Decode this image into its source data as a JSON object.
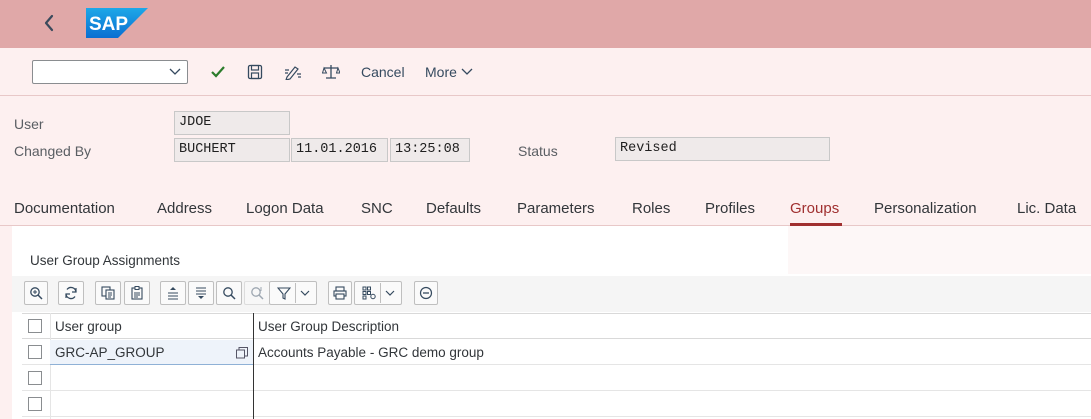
{
  "header": {
    "logo_text": "SAP",
    "brand_color": "#0a6ed1"
  },
  "toolbar": {
    "command_field_value": "",
    "cancel_label": "Cancel",
    "more_label": "More"
  },
  "form": {
    "user_label": "User",
    "user_value": "JDOE",
    "changed_by_label": "Changed By",
    "changed_by_value": "BUCHERT",
    "changed_date": "11.01.2016",
    "changed_time": "13:25:08",
    "status_label": "Status",
    "status_value": "Revised"
  },
  "tabs": [
    {
      "label": "Documentation"
    },
    {
      "label": "Address"
    },
    {
      "label": "Logon Data"
    },
    {
      "label": "SNC"
    },
    {
      "label": "Defaults"
    },
    {
      "label": "Parameters"
    },
    {
      "label": "Roles"
    },
    {
      "label": "Profiles"
    },
    {
      "label": "Groups",
      "active": true
    },
    {
      "label": "Personalization"
    },
    {
      "label": "Lic. Data"
    }
  ],
  "section": {
    "title": "User Group Assignments"
  },
  "grid": {
    "columns": [
      "User group",
      "User Group Description"
    ],
    "rows": [
      {
        "group": "GRC-AP_GROUP",
        "description": "Accounts Payable - GRC demo group"
      },
      {
        "group": "",
        "description": ""
      },
      {
        "group": "",
        "description": ""
      }
    ]
  },
  "icons": {
    "back": "back-icon",
    "confirm": "check-icon",
    "save": "save-icon",
    "edit": "edit-icon",
    "compare": "scale-icon"
  }
}
